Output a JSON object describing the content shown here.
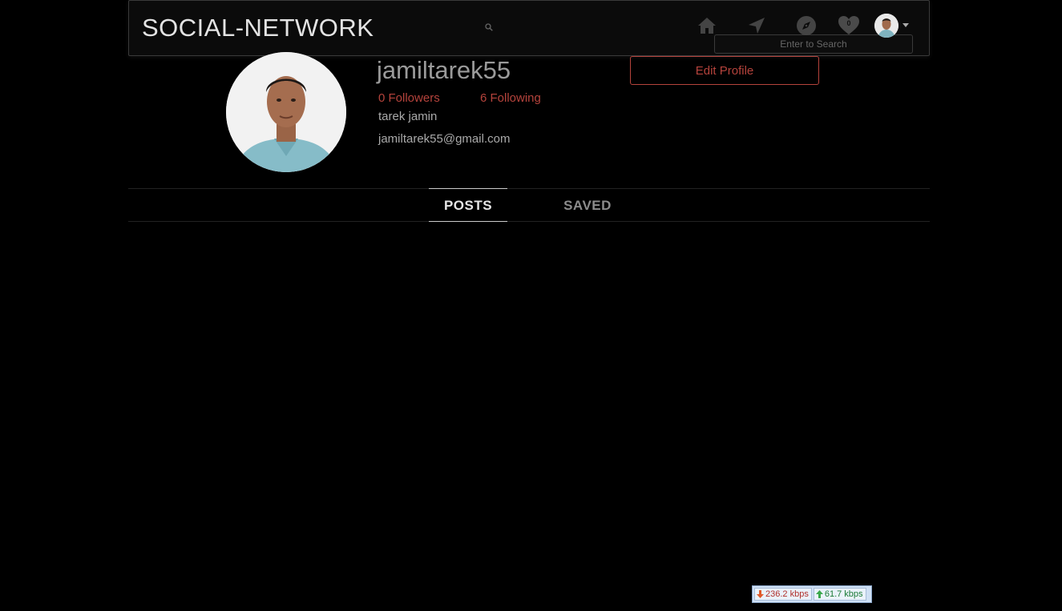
{
  "header": {
    "brand": "SOCIAL-NETWORK",
    "search_placeholder": "Enter to Search",
    "notifications_count": "0"
  },
  "profile": {
    "username": "jamiltarek55",
    "followers_label": "0 Followers",
    "following_label": "6 Following",
    "full_name": "tarek jamin",
    "email": "jamiltarek55@gmail.com",
    "edit_button": "Edit Profile"
  },
  "tabs": [
    {
      "label": "POSTS",
      "active": true
    },
    {
      "label": "SAVED",
      "active": false
    }
  ],
  "net_meter": {
    "download": "236.2 kbps",
    "upload": "61.7 kbps"
  },
  "colors": {
    "accent": "#b5433c",
    "background": "#000000",
    "navbar_bg": "#0b0b0b"
  },
  "icons": [
    "home-icon",
    "send-icon",
    "compass-icon",
    "heart-icon",
    "search-icon"
  ]
}
